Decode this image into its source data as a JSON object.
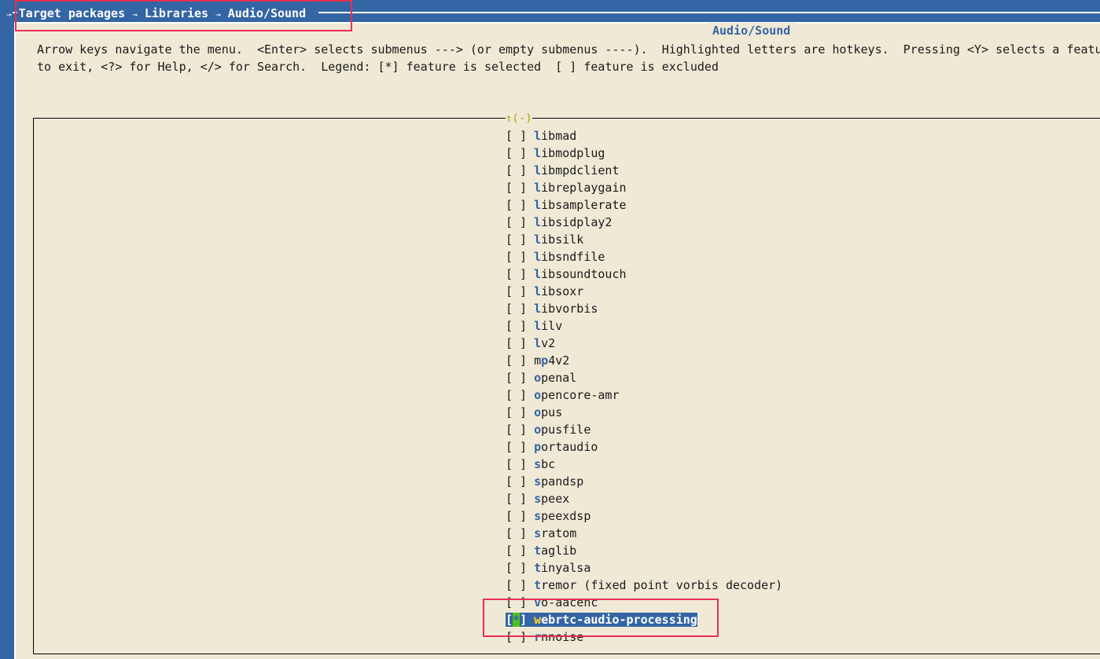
{
  "breadcrumb": {
    "parts": [
      "Target packages",
      "Libraries",
      "Audio/Sound"
    ],
    "separator": "→",
    "leading_arrow": "→"
  },
  "panel": {
    "title": "Audio/Sound",
    "help_line1": "Arrow keys navigate the menu.  <Enter> selects submenus ---> (or empty submenus ----).  Highlighted letters are hotkeys.  Pressing <Y> selects a featu",
    "help_line2": "to exit, <?> for Help, </> for Search.  Legend: [*] feature is selected  [ ] feature is excluded",
    "scroll_indicator": "↑(-)"
  },
  "items": [
    {
      "box": "[ ]",
      "hotkey": "l",
      "rest": "ibmad"
    },
    {
      "box": "[ ]",
      "hotkey": "l",
      "rest": "ibmodplug"
    },
    {
      "box": "[ ]",
      "hotkey": "l",
      "rest": "ibmpdclient"
    },
    {
      "box": "[ ]",
      "hotkey": "l",
      "rest": "ibreplaygain"
    },
    {
      "box": "[ ]",
      "hotkey": "l",
      "rest": "ibsamplerate"
    },
    {
      "box": "[ ]",
      "hotkey": "l",
      "rest": "ibsidplay2"
    },
    {
      "box": "[ ]",
      "hotkey": "l",
      "rest": "ibsilk"
    },
    {
      "box": "[ ]",
      "hotkey": "l",
      "rest": "ibsndfile"
    },
    {
      "box": "[ ]",
      "hotkey": "l",
      "rest": "ibsoundtouch"
    },
    {
      "box": "[ ]",
      "hotkey": "l",
      "rest": "ibsoxr"
    },
    {
      "box": "[ ]",
      "hotkey": "l",
      "rest": "ibvorbis"
    },
    {
      "box": "[ ]",
      "hotkey": "l",
      "rest": "ilv"
    },
    {
      "box": "[ ]",
      "hotkey": "l",
      "rest": "v2"
    },
    {
      "box": "[ ]",
      "hotkey": "",
      "rest": "mp4v2",
      "hk_index": 2
    },
    {
      "box": "[ ]",
      "hotkey": "o",
      "rest": "penal"
    },
    {
      "box": "[ ]",
      "hotkey": "o",
      "rest": "pencore-amr"
    },
    {
      "box": "[ ]",
      "hotkey": "o",
      "rest": "pus"
    },
    {
      "box": "[ ]",
      "hotkey": "o",
      "rest": "pusfile"
    },
    {
      "box": "[ ]",
      "hotkey": "p",
      "rest": "ortaudio"
    },
    {
      "box": "[ ]",
      "hotkey": "s",
      "rest": "bc"
    },
    {
      "box": "[ ]",
      "hotkey": "s",
      "rest": "pandsp"
    },
    {
      "box": "[ ]",
      "hotkey": "s",
      "rest": "peex"
    },
    {
      "box": "[ ]",
      "hotkey": "s",
      "rest": "peexdsp"
    },
    {
      "box": "[ ]",
      "hotkey": "s",
      "rest": "ratom"
    },
    {
      "box": "[ ]",
      "hotkey": "t",
      "rest": "aglib"
    },
    {
      "box": "[ ]",
      "hotkey": "t",
      "rest": "inyalsa"
    },
    {
      "box": "[ ]",
      "hotkey": "t",
      "rest": "remor (fixed point vorbis decoder)"
    },
    {
      "box": "[ ]",
      "hotkey": "v",
      "rest": "o-aacenc"
    },
    {
      "box": "[*]",
      "hotkey": "w",
      "rest": "ebrtc-audio-processing",
      "selected": true
    },
    {
      "box": "[ ]",
      "hotkey": "r",
      "rest": "nnoise"
    }
  ],
  "colors": {
    "background": "#3465a4",
    "panel": "#f0e9d6",
    "hotkey": "#3465a4",
    "highlight_box": "#e8304f",
    "cursor": "#4ec21c"
  }
}
